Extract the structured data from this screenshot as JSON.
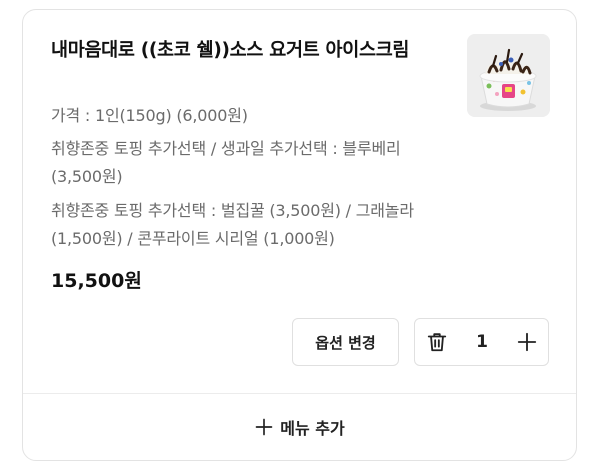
{
  "item": {
    "title": "내마음대로 ((초코 쉘))소스 요거트 아이스크림",
    "options": [
      "가격 : 1인(150g) (6,000원)",
      "취향존중 토핑 추가선택 / 생과일 추가선택 : 블루베리 (3,500원)",
      "취향존중 토핑 추가선택 : 벌집꿀 (3,500원) / 그래놀라 (1,500원) / 콘푸라이트 시리얼 (1,000원)"
    ],
    "price": "15,500원",
    "thumbnail_icon": "yogurt-ice-cream-cup-image"
  },
  "actions": {
    "change_option_label": "옵션 변경",
    "quantity": "1",
    "delete_icon": "trash-icon",
    "increase_icon": "plus-icon"
  },
  "footer": {
    "add_menu_label": "메뉴 추가",
    "add_icon": "plus-icon"
  }
}
